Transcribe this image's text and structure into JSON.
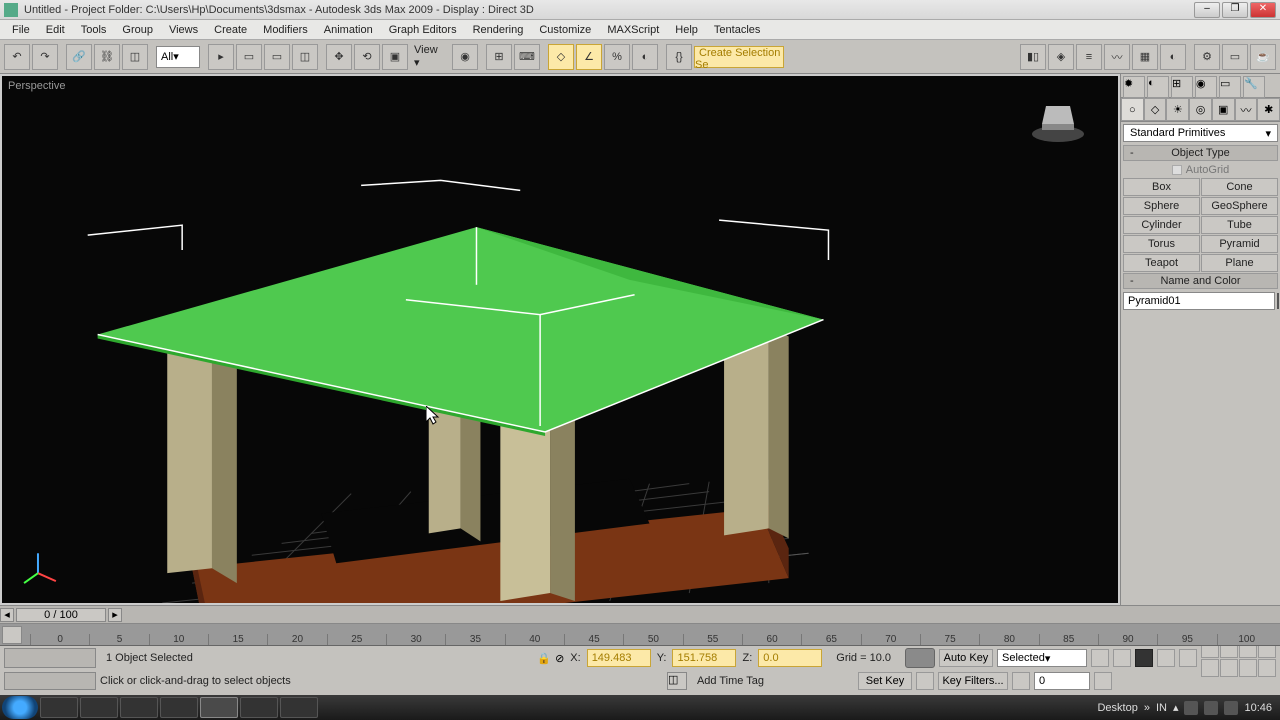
{
  "title": "Untitled     - Project Folder: C:\\Users\\Hp\\Documents\\3dsmax        - Autodesk 3ds Max  2009        - Display : Direct 3D",
  "menu": [
    "File",
    "Edit",
    "Tools",
    "Group",
    "Views",
    "Create",
    "Modifiers",
    "Animation",
    "Graph Editors",
    "Rendering",
    "Customize",
    "MAXScript",
    "Help",
    "Tentacles"
  ],
  "toolbar": {
    "all": "All",
    "view": "View",
    "sel_set": "Create Selection Se"
  },
  "viewport_label": "Perspective",
  "cmd_panel": {
    "category": "Standard Primitives",
    "object_type_header": "Object Type",
    "autogrid": "AutoGrid",
    "objects": [
      "Box",
      "Cone",
      "Sphere",
      "GeoSphere",
      "Cylinder",
      "Tube",
      "Torus",
      "Pyramid",
      "Teapot",
      "Plane"
    ],
    "name_color_header": "Name and Color",
    "object_name": "Pyramid01",
    "object_color": "#3cc23c"
  },
  "time": {
    "slider": "0 / 100",
    "ticks": [
      "0",
      "5",
      "10",
      "15",
      "20",
      "25",
      "30",
      "35",
      "40",
      "45",
      "50",
      "55",
      "60",
      "65",
      "70",
      "75",
      "80",
      "85",
      "90",
      "95",
      "100"
    ]
  },
  "status": {
    "selection": "1 Object Selected",
    "prompt": "Click or click-and-drag to select objects",
    "x_label": "X:",
    "x_val": "149.483",
    "y_label": "Y:",
    "y_val": "151.758",
    "z_label": "Z:",
    "z_val": "0.0",
    "grid": "Grid = 10.0",
    "auto_key": "Auto Key",
    "set_key": "Set Key",
    "key_mode": "Selected",
    "key_filters": "Key Filters...",
    "frame": "0",
    "add_tag": "Add Time Tag"
  },
  "taskbar": {
    "desktop": "Desktop",
    "lang": "IN",
    "clock": "10:46"
  }
}
